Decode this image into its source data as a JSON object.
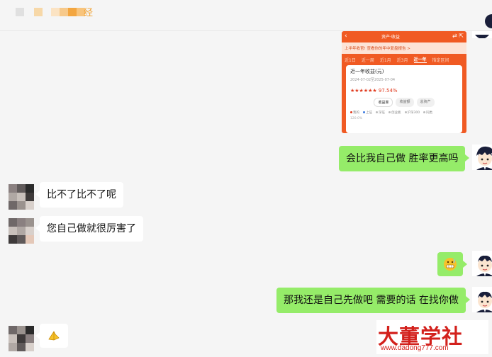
{
  "header": {
    "title": "经",
    "colors": {
      "accent": "#f0a030",
      "mosaic_gray": "#d8d8d8",
      "mosaic_orange": "#f7c98a"
    }
  },
  "embedded_screenshot": {
    "top_title": "资产·收益",
    "banner": "上半年收官! 查看你的年中复盘报告 >",
    "tabs": [
      "近1日",
      "近一周",
      "近1月",
      "近3月",
      "近一年",
      "指定区间"
    ],
    "active_tab": "近一年",
    "card_title": "近一年收益(元)",
    "date_range": "2024-07-02至2025-07-04",
    "stars": "★★★★★★",
    "percent": "97.54%",
    "pills": [
      "收益率",
      "收益额",
      "总资产"
    ],
    "legend": [
      "我的",
      "上证",
      "深证",
      "创业板",
      "沪深300",
      "同类"
    ],
    "axis_start": "120.0%"
  },
  "messages": [
    {
      "sender": "me",
      "text": "会比我自己做 胜率更高吗"
    },
    {
      "sender": "them",
      "text": "比不了比不了呢"
    },
    {
      "sender": "them",
      "text": "您自己做就很厉害了"
    },
    {
      "sender": "me",
      "text": "",
      "emoji": "grimace-emoji"
    },
    {
      "sender": "me",
      "text": "那我还是自己先做吧 需要的话 在找你做"
    },
    {
      "sender": "them",
      "text": "",
      "emoji": "pray-emoji"
    }
  ],
  "watermark": {
    "name": "大董学社",
    "url": "www.dadong777.com",
    "color": "#d3211c"
  },
  "colors": {
    "my_bubble": "#95ec69",
    "their_bubble": "#ffffff",
    "background": "#f5f5f5",
    "app_orange": "#f05a23"
  }
}
